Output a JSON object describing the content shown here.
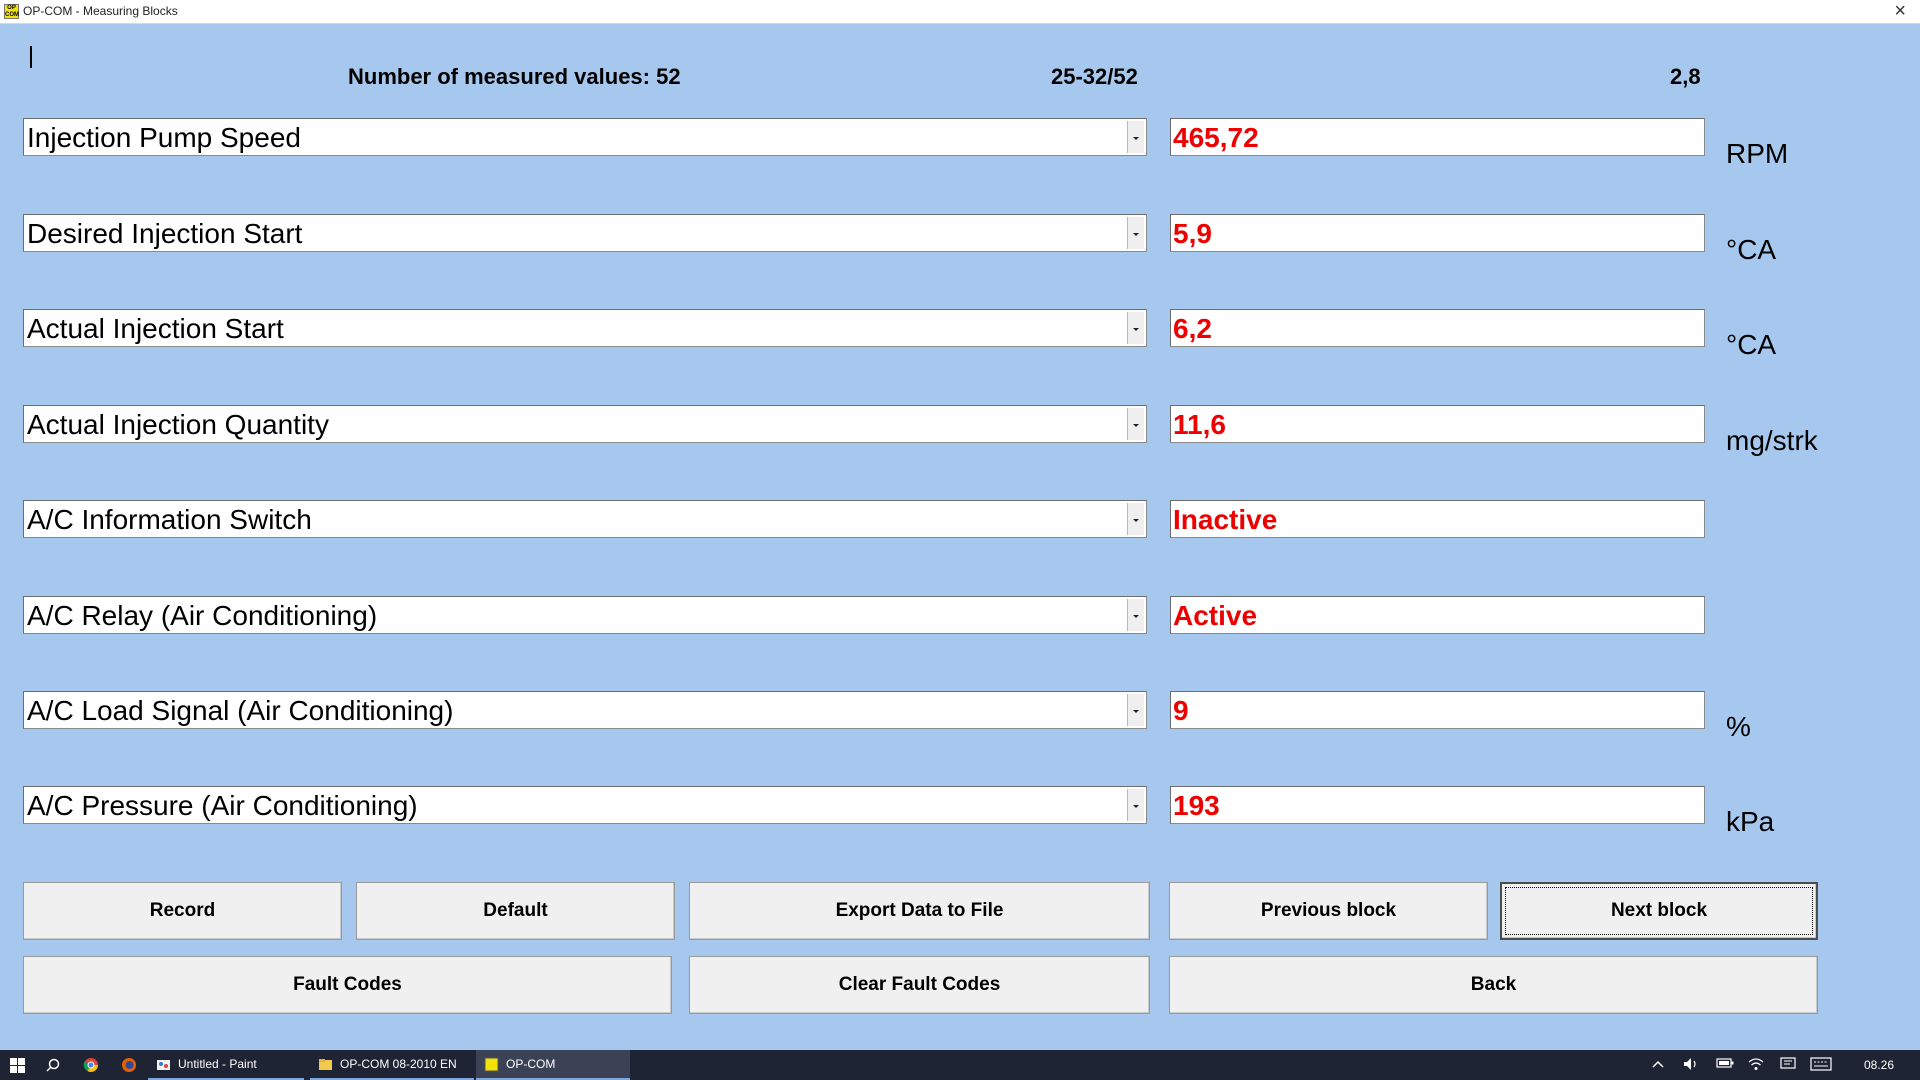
{
  "window": {
    "title": "OP-COM - Measuring Blocks",
    "icon_text": "OP COM",
    "close_symbol": "×"
  },
  "header": {
    "count_label": "Number of measured values: 52",
    "range_label": "25-32/52",
    "version_label": "2,8"
  },
  "rows": [
    {
      "parameter": "Injection Pump Speed",
      "value": "465,72",
      "unit": "RPM"
    },
    {
      "parameter": "Desired Injection Start",
      "value": "5,9",
      "unit": "°CA"
    },
    {
      "parameter": "Actual Injection Start",
      "value": "6,2",
      "unit": "°CA"
    },
    {
      "parameter": "Actual Injection Quantity",
      "value": "11,6",
      "unit": "mg/strk"
    },
    {
      "parameter": "A/C Information Switch",
      "value": "Inactive",
      "unit": ""
    },
    {
      "parameter": "A/C Relay (Air Conditioning)",
      "value": "Active",
      "unit": ""
    },
    {
      "parameter": "A/C Load Signal (Air Conditioning)",
      "value": "9",
      "unit": "%"
    },
    {
      "parameter": "A/C Pressure (Air Conditioning)",
      "value": "193",
      "unit": "kPa"
    }
  ],
  "buttons": {
    "record": "Record",
    "default": "Default",
    "export": "Export Data to File",
    "previous": "Previous block",
    "next": "Next block",
    "fault_codes": "Fault Codes",
    "clear_fault_codes": "Clear Fault Codes",
    "back": "Back"
  },
  "taskbar": {
    "tasks": [
      {
        "label": "Untitled - Paint"
      },
      {
        "label": "OP-COM 08-2010 EN"
      },
      {
        "label": "OP-COM"
      }
    ],
    "clock": "08.26"
  },
  "colors": {
    "background": "#a6c8ee",
    "value_text": "#ee0000",
    "taskbar": "#1e2433"
  }
}
